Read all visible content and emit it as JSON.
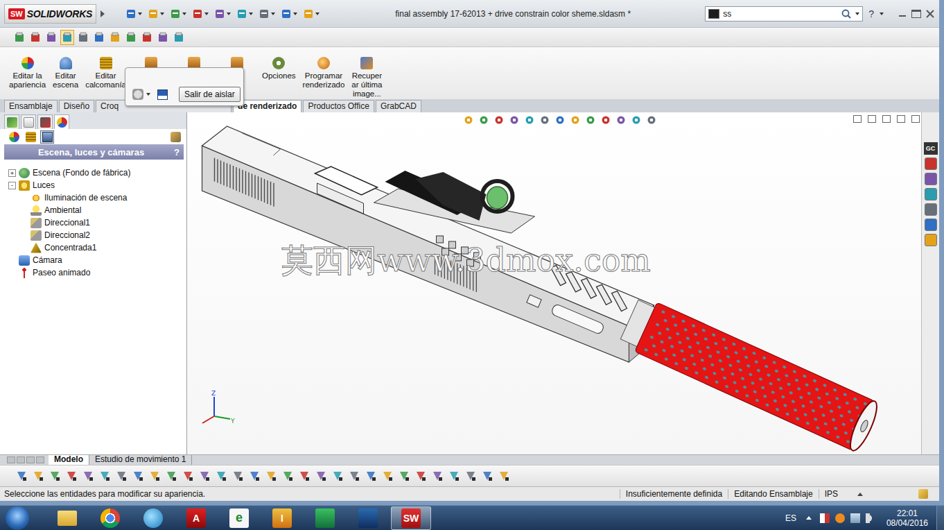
{
  "window": {
    "title": "final assembly 17-62013 + drive constrain color sheme.sldasm *",
    "logo": {
      "badge": "SW",
      "name": "SOLIDWORKS"
    },
    "help": "?"
  },
  "search": {
    "value": "ss"
  },
  "view_toolbar": [
    {
      "selected": false
    },
    {
      "selected": false
    },
    {
      "selected": false
    },
    {
      "selected": true
    },
    {
      "selected": false
    },
    {
      "selected": false
    },
    {
      "selected": false
    },
    {
      "selected": false
    },
    {
      "selected": false
    },
    {
      "selected": false
    },
    {
      "selected": false
    }
  ],
  "ribbon": {
    "buttons": [
      {
        "kind": "appearance",
        "lines": [
          "Editar la",
          "apariencia"
        ]
      },
      {
        "kind": "scene",
        "lines": [
          "Editar",
          "escena"
        ]
      },
      {
        "kind": "decal",
        "lines": [
          "Editar",
          "calcomanía"
        ]
      },
      {
        "kind": "covered",
        "lines": []
      },
      {
        "kind": "covered",
        "lines": []
      },
      {
        "kind": "covered",
        "lines": []
      },
      {
        "kind": "options",
        "lines": [
          "Opciones"
        ]
      },
      {
        "kind": "schedule",
        "lines": [
          "Programar",
          "renderizado"
        ]
      },
      {
        "kind": "recover",
        "lines": [
          "Recuper",
          "ar última",
          "image..."
        ]
      }
    ]
  },
  "isolate_popup": {
    "button": "Salir de aislar"
  },
  "command_tabs": [
    {
      "label": "Ensamblaje",
      "selected": false,
      "under_popup": false
    },
    {
      "label": "Diseño",
      "selected": false,
      "under_popup": false
    },
    {
      "label": "Croq",
      "selected": false,
      "under_popup": true
    },
    {
      "label": "de renderizado",
      "selected": true,
      "under_popup": false
    },
    {
      "label": "Productos Office",
      "selected": false,
      "under_popup": false
    },
    {
      "label": "GrabCAD",
      "selected": false,
      "under_popup": false
    }
  ],
  "panel": {
    "tabs": [
      {
        "kind": "tree",
        "selected": false
      },
      {
        "kind": "properties",
        "selected": false
      },
      {
        "kind": "configurations",
        "selected": false
      },
      {
        "kind": "display",
        "selected": true
      }
    ],
    "view_tabs": [
      {
        "kind": "appearances",
        "selected": false
      },
      {
        "kind": "decals",
        "selected": false
      },
      {
        "kind": "scenes",
        "selected": true
      }
    ],
    "title": "Escena, luces y cámaras",
    "help": "?",
    "tree": [
      {
        "label": "Escena (Fondo de fábrica)",
        "kind": "scene",
        "toggle": "+",
        "expanded": false,
        "children": []
      },
      {
        "label": "Luces",
        "kind": "lights",
        "toggle": "-",
        "expanded": true,
        "children": [
          {
            "label": "Iluminación de escena",
            "kind": "scene-light"
          },
          {
            "label": "Ambiental",
            "kind": "ambient"
          },
          {
            "label": "Direccional1",
            "kind": "directional"
          },
          {
            "label": "Direccional2",
            "kind": "directional"
          },
          {
            "label": "Concentrada1",
            "kind": "spot"
          }
        ]
      },
      {
        "label": "Cámara",
        "kind": "camera",
        "toggle": "",
        "expanded": false,
        "children": []
      },
      {
        "label": "Paseo animado",
        "kind": "walkthrough",
        "toggle": "",
        "expanded": false,
        "children": []
      }
    ]
  },
  "viewport": {
    "watermark": "莫西网www.3dmox.com",
    "axes": {
      "z": "Z",
      "y": "Y"
    }
  },
  "task_pane": {
    "badge": "GC"
  },
  "bottom_tabs": [
    {
      "label": "Modelo",
      "selected": true
    },
    {
      "label": "Estudio de movimiento 1",
      "selected": false
    }
  ],
  "status_bar": {
    "message": "Seleccione las entidades para modificar su apariencia.",
    "sections": [
      "Insuficientemente definida",
      "Editando Ensamblaje",
      "IPS"
    ]
  },
  "taskbar": {
    "apps": [
      {
        "kind": "explorer",
        "glyph": "",
        "active": false
      },
      {
        "kind": "chrome",
        "glyph": "",
        "active": false
      },
      {
        "kind": "swirl",
        "glyph": "",
        "active": false
      },
      {
        "kind": "autocad",
        "glyph": "A",
        "active": false
      },
      {
        "kind": "edrawings",
        "glyph": "e",
        "active": false
      },
      {
        "kind": "inventor",
        "glyph": "I",
        "active": false
      },
      {
        "kind": "green",
        "glyph": "",
        "active": false
      },
      {
        "kind": "revit",
        "glyph": "",
        "active": false
      },
      {
        "kind": "solidworks",
        "glyph": "SW",
        "active": true
      }
    ],
    "tray": {
      "language": "ES",
      "time": "22:01",
      "date": "08/04/2016"
    }
  }
}
